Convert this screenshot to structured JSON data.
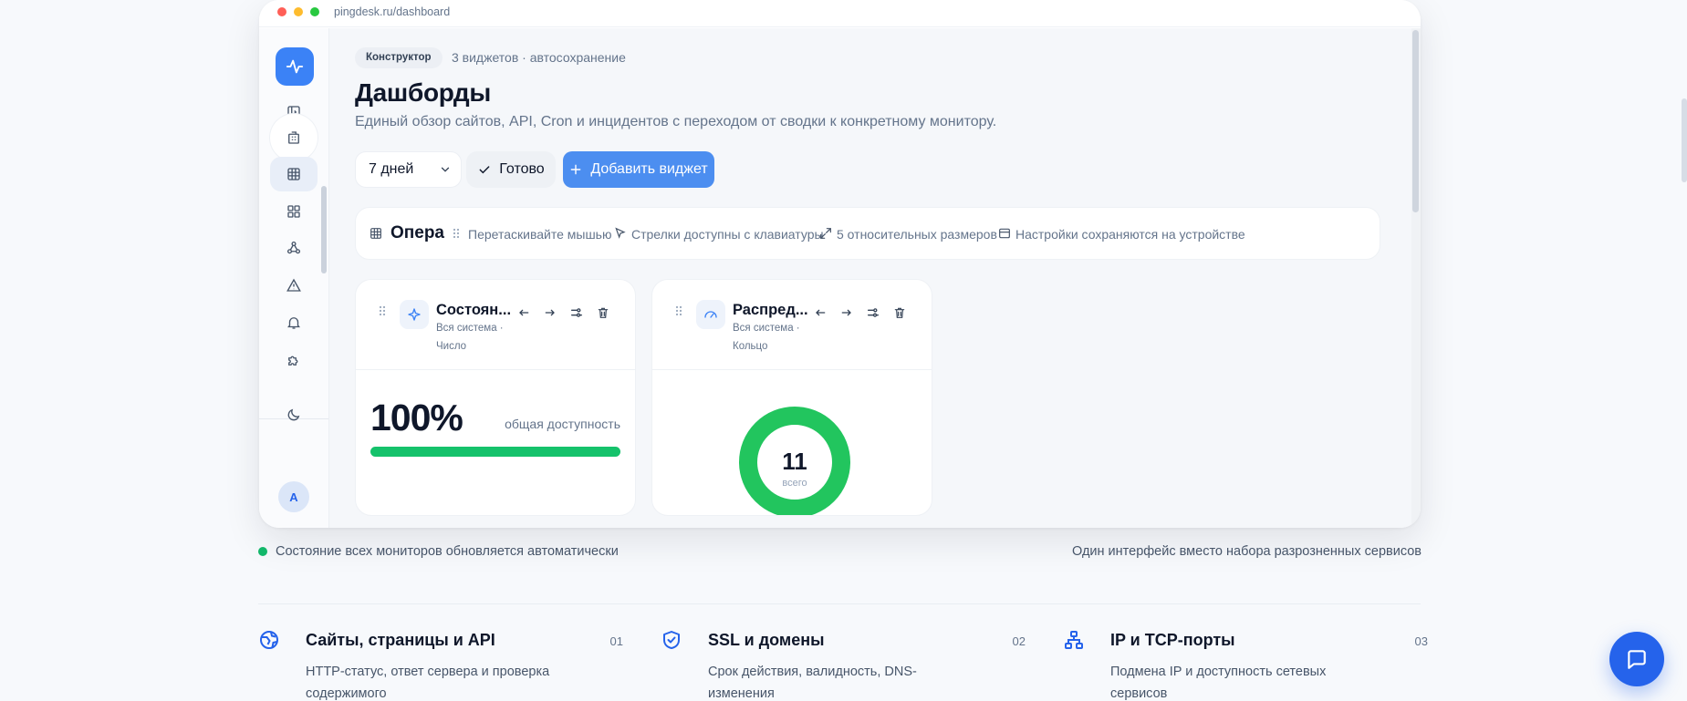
{
  "browser": {
    "url": "pingdesk.ru/dashboard"
  },
  "header": {
    "chip": "Конструктор",
    "meta": "3 виджетов · автосохранение",
    "title": "Дашборды",
    "subtitle": "Единый обзор сайтов, API, Cron и инцидентов с переходом от сводки к конкретному монитору."
  },
  "controls": {
    "period": "7 дней",
    "ready_label": "Готово",
    "add_label": "Добавить виджет"
  },
  "toolbar": {
    "title": "Опера",
    "hints": [
      "Перетаскивайте мышью",
      "Стрелки доступны с клавиатуры",
      "5 относительных размеров",
      "Настройки сохраняются на устройстве"
    ]
  },
  "widgets": [
    {
      "title": "Состоян...",
      "scope": "Вся система",
      "kind": "Число",
      "value": "100%",
      "caption": "общая доступность",
      "progress": 1.0,
      "icon": "sparkle-icon"
    },
    {
      "title": "Распред...",
      "scope": "Вся система",
      "kind": "Кольцо",
      "value": "11",
      "caption": "всего",
      "icon": "gauge-icon"
    }
  ],
  "sidebar": {
    "avatar": "A",
    "icons": [
      "panel-toggle-icon",
      "building-icon",
      "grid-icon",
      "widgets-icon",
      "webhook-icon",
      "alert-triangle-icon",
      "bell-icon",
      "puzzle-icon",
      "moon-icon"
    ]
  },
  "status": {
    "left": "Состояние всех мониторов обновляется автоматически",
    "right": "Один интерфейс вместо набора разрозненных сервисов"
  },
  "features": [
    {
      "title": "Сайты, страницы и API",
      "num": "01",
      "desc": "HTTP-статус, ответ сервера и проверка содержимого"
    },
    {
      "title": "SSL и домены",
      "num": "02",
      "desc": "Срок действия, валидность, DNS-изменения"
    },
    {
      "title": "IP и TCP-порты",
      "num": "03",
      "desc": "Подмена IP и доступность сетевых сервисов"
    }
  ],
  "colors": {
    "accent": "#3b82f6",
    "success": "#15c26b",
    "chat": "#2563eb"
  }
}
